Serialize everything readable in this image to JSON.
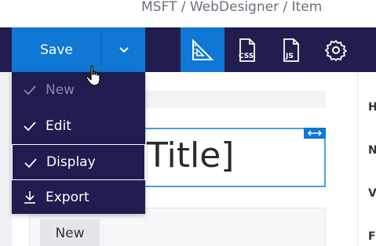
{
  "breadcrumb": {
    "text": "MSFT / WebDesigner / Item"
  },
  "toolbar": {
    "save_label": "Save",
    "dropdown_icon": "chevron-down-icon",
    "tools": [
      {
        "name": "design-ruler",
        "icon": "ruler-triangle-icon",
        "active": true
      },
      {
        "name": "css",
        "icon": "css-file-icon",
        "active": false
      },
      {
        "name": "js",
        "icon": "js-file-icon",
        "active": false
      },
      {
        "name": "settings",
        "icon": "gear-icon",
        "active": false
      }
    ]
  },
  "menu": {
    "items": [
      {
        "label": "New",
        "icon": "check-icon",
        "disabled": true
      },
      {
        "label": "Edit",
        "icon": "check-icon",
        "disabled": false
      },
      {
        "label": "Display",
        "icon": "check-icon",
        "disabled": false,
        "focused": true
      },
      {
        "label": "Export",
        "icon": "download-icon",
        "disabled": false
      }
    ]
  },
  "canvas": {
    "title_text": "Title]",
    "resize_icon": "horizontal-resize-icon",
    "new_tab_label": "New"
  },
  "properties": {
    "letters": [
      "H",
      "N",
      "V",
      "F"
    ]
  },
  "colors": {
    "toolbar_bg": "#211d4e",
    "accent": "#0f78d4",
    "menu_bg": "#1f1c4f",
    "selection_border": "#4a9fe8"
  }
}
